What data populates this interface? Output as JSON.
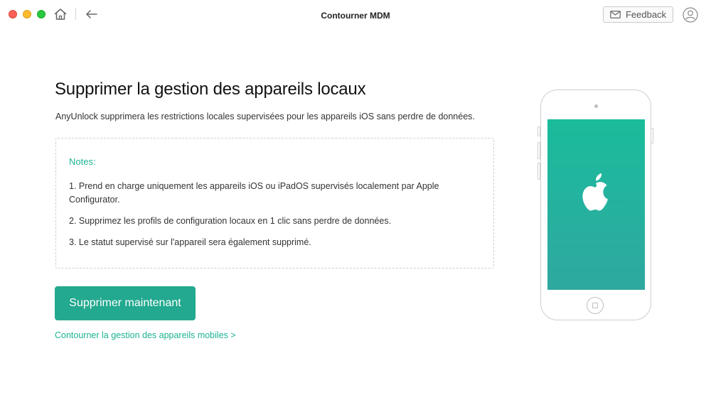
{
  "window": {
    "title": "Contourner MDM"
  },
  "toolbar": {
    "home_icon": "home-icon",
    "back_icon": "back-arrow-icon",
    "feedback_label": "Feedback",
    "feedback_icon": "mail-icon",
    "account_icon": "user-icon"
  },
  "main": {
    "title": "Supprimer la gestion des appareils locaux",
    "description": "AnyUnlock supprimera les restrictions locales supervisées pour les appareils iOS sans perdre de données.",
    "notes": {
      "title": "Notes:",
      "items": [
        "1. Prend en charge uniquement les appareils iOS ou iPadOS supervisés localement par Apple Configurator.",
        "2. Supprimez les profils de configuration locaux en 1 clic sans perdre de données.",
        "3. Le statut supervisé sur l'appareil sera également supprimé."
      ]
    },
    "primary_button": "Supprimer maintenant",
    "secondary_link": "Contourner la gestion des appareils mobiles >"
  },
  "illustration": {
    "device": "iphone",
    "logo_icon": "apple-logo-icon"
  },
  "colors": {
    "accent": "#23a98f",
    "accent_text": "#1db394",
    "screen_top": "#1abc9c",
    "screen_bottom": "#2fa8a0",
    "traffic_close": "#fc5f57",
    "traffic_minimize": "#fdbc2e",
    "traffic_maximize": "#29c840"
  }
}
